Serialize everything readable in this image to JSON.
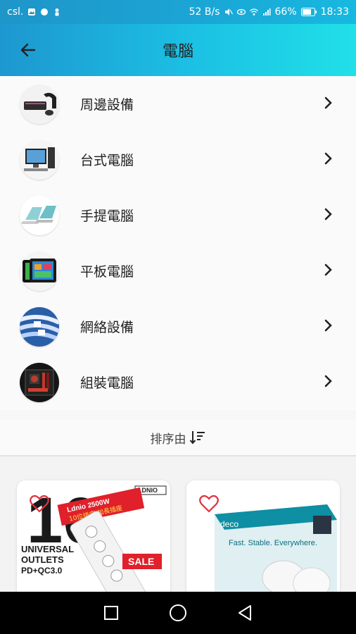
{
  "status_bar": {
    "carrier": "csl.",
    "net_speed": "52 B/s",
    "battery": "66%",
    "time": "18:33"
  },
  "app_bar": {
    "title": "電腦"
  },
  "categories": [
    {
      "label": "周邊設備",
      "icon": "peripherals-thumbnail"
    },
    {
      "label": "台式電腦",
      "icon": "desktop-thumbnail"
    },
    {
      "label": "手提電腦",
      "icon": "laptop-thumbnail"
    },
    {
      "label": "平板電腦",
      "icon": "tablet-thumbnail"
    },
    {
      "label": "網絡設備",
      "icon": "network-thumbnail"
    },
    {
      "label": "組裝電腦",
      "icon": "custom-pc-thumbnail"
    }
  ],
  "sort": {
    "label": "排序由"
  },
  "products": [
    {
      "brand": "LDNIO",
      "headline_big": "10",
      "headline_sub": "UNIVERSAL OUTLETS",
      "spec": "PD+QC3.0",
      "banner": "Ldnio 2500W",
      "banner_sub": "10位插座 加長插座",
      "sale_tag": "SALE"
    },
    {
      "brand": "deco",
      "tagline": "Fast. Stable. Everywhere."
    }
  ],
  "colors": {
    "accent_start": "#1d97d0",
    "accent_end": "#20e0e8",
    "heart": "#e0323d",
    "sale_red": "#e0202a"
  }
}
